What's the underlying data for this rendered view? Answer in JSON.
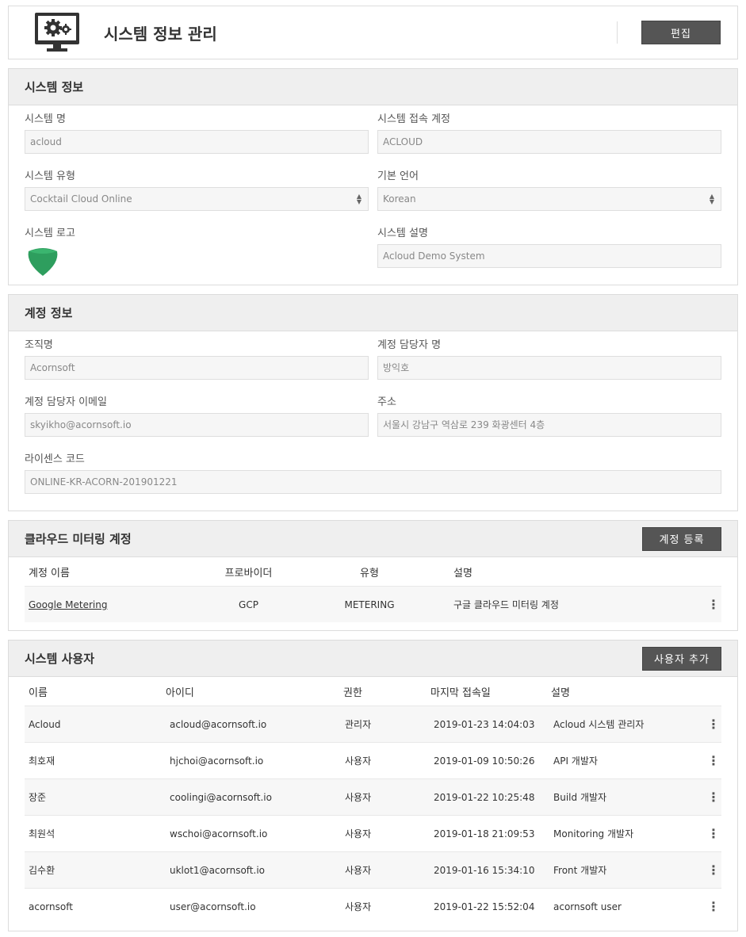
{
  "header": {
    "title": "시스템 정보 관리",
    "edit_label": "편집",
    "icon": "monitor-gear-icon"
  },
  "system_info": {
    "title": "시스템 정보",
    "name": {
      "label": "시스템 명",
      "value": "acloud"
    },
    "access_account": {
      "label": "시스템 접속 계정",
      "value": "ACLOUD"
    },
    "type": {
      "label": "시스템 유형",
      "value": "Cocktail Cloud Online"
    },
    "language": {
      "label": "기본 언어",
      "value": "Korean"
    },
    "logo": {
      "label": "시스템 로고",
      "icon": "acorn-logo-icon",
      "color": "#2e9e5e"
    },
    "description": {
      "label": "시스템 설명",
      "value": "Acloud Demo System"
    }
  },
  "account_info": {
    "title": "계정 정보",
    "org": {
      "label": "조직명",
      "value": "Acornsoft"
    },
    "manager": {
      "label": "계정 담당자 명",
      "value": "방익호"
    },
    "email": {
      "label": "계정 담당자 이메일",
      "value": "skyikho@acornsoft.io"
    },
    "address": {
      "label": "주소",
      "value": "서울시 강남구 역삼로 239 화광센터 4층"
    },
    "license": {
      "label": "라이센스 코드",
      "value": "ONLINE-KR-ACORN-201901221"
    }
  },
  "metering": {
    "title": "클라우드 미터링 계정",
    "register_label": "계정 등록",
    "columns": [
      "계정 이름",
      "프로바이더",
      "유형",
      "설명"
    ],
    "rows": [
      {
        "name": "Google Metering",
        "provider": "GCP",
        "type": "METERING",
        "desc": "구글 클라우드 미터링 계정"
      }
    ]
  },
  "users": {
    "title": "시스템 사용자",
    "add_label": "사용자 추가",
    "columns": [
      "이름",
      "아이디",
      "권한",
      "마지막 접속일",
      "설명"
    ],
    "rows": [
      {
        "name": "Acloud",
        "id": "acloud@acornsoft.io",
        "role": "관리자",
        "last": "2019-01-23 14:04:03",
        "desc": "Acloud 시스템 관리자"
      },
      {
        "name": "최호재",
        "id": "hjchoi@acornsoft.io",
        "role": "사용자",
        "last": "2019-01-09 10:50:26",
        "desc": "API 개발자"
      },
      {
        "name": "장준",
        "id": "coolingi@acornsoft.io",
        "role": "사용자",
        "last": "2019-01-22 10:25:48",
        "desc": "Build 개발자"
      },
      {
        "name": "최원석",
        "id": "wschoi@acornsoft.io",
        "role": "사용자",
        "last": "2019-01-18 21:09:53",
        "desc": "Monitoring 개발자"
      },
      {
        "name": "김수환",
        "id": "uklot1@acornsoft.io",
        "role": "사용자",
        "last": "2019-01-16 15:34:10",
        "desc": "Front 개발자"
      },
      {
        "name": "acornsoft",
        "id": "user@acornsoft.io",
        "role": "사용자",
        "last": "2019-01-22 15:52:04",
        "desc": "acornsoft user"
      }
    ]
  }
}
